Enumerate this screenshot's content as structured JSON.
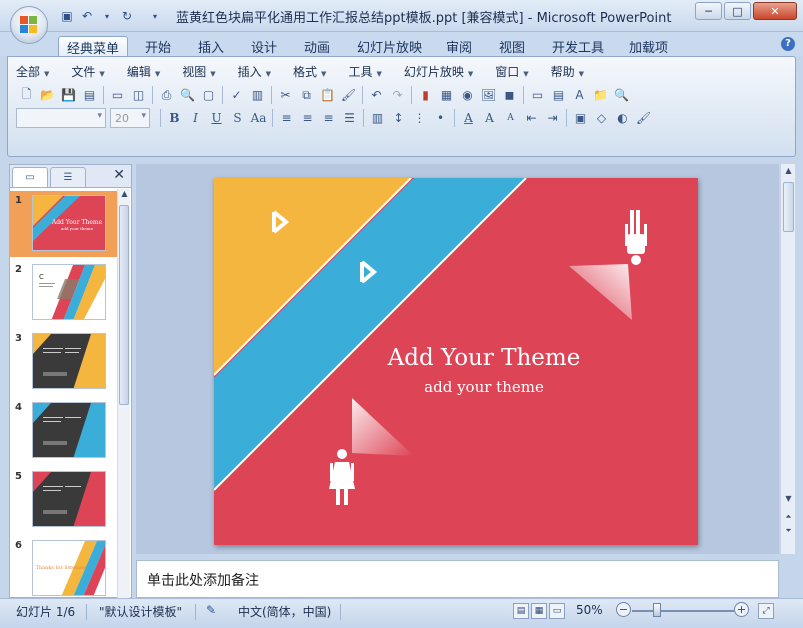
{
  "window": {
    "title": "蓝黄红色块扁平化通用工作汇报总结ppt模板.ppt [兼容模式] - Microsoft PowerPoint",
    "controls": {
      "minimize": "─",
      "maximize": "□",
      "close": "✕"
    }
  },
  "ribbon_tabs": [
    "经典菜单",
    "开始",
    "插入",
    "设计",
    "动画",
    "幻灯片放映",
    "审阅",
    "视图",
    "开发工具",
    "加载项"
  ],
  "menus": [
    "全部",
    "文件",
    "编辑",
    "视图",
    "插入",
    "格式",
    "工具",
    "幻灯片放映",
    "窗口",
    "帮助"
  ],
  "toolbar": {
    "font_name": "",
    "font_size": "20",
    "bold": "B",
    "italic": "I",
    "underline": "U",
    "shadow": "S",
    "case": "Aa",
    "text_color": "A",
    "grow": "A",
    "shrink": "A"
  },
  "thumbnails": [
    {
      "num": "1",
      "title": "Add Your Theme"
    },
    {
      "num": "2",
      "title": "C"
    },
    {
      "num": "3",
      "title": ""
    },
    {
      "num": "4",
      "title": ""
    },
    {
      "num": "5",
      "title": ""
    },
    {
      "num": "6",
      "title": "Thanks for listening"
    }
  ],
  "slide": {
    "title": "Add Your Theme",
    "subtitle": "add your theme",
    "colors": {
      "yellow": "#f5b63f",
      "blue": "#3badd9",
      "red": "#dd4456"
    }
  },
  "notes": {
    "placeholder": "单击此处添加备注"
  },
  "status": {
    "slide_counter": "幻灯片 1/6",
    "theme": "\"默认设计模板\"",
    "language": "中文(简体，中国)",
    "zoom": "50%"
  }
}
